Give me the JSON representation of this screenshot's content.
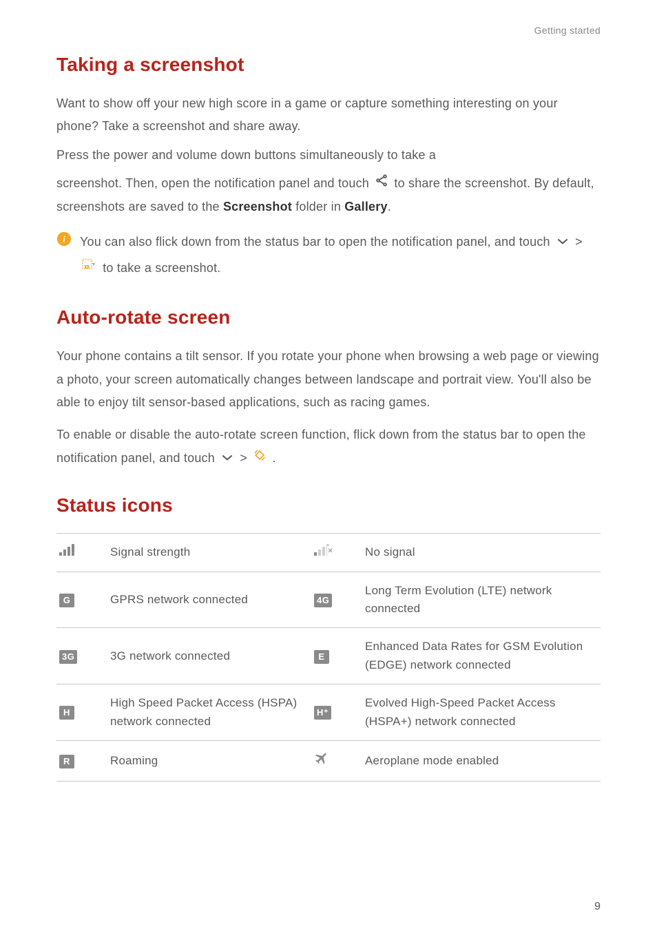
{
  "header": "Getting started",
  "section1": {
    "title": "Taking a screenshot",
    "para1_a": "Want to show off your new high score in a game or capture something interesting on your phone? Take a screenshot and share away.",
    "para1_b": "Press the power and volume down buttons simultaneously to take a",
    "para2_a": "screenshot. Then, open the notification panel and touch ",
    "para2_b": " to share the screenshot. By default, screenshots are saved to the ",
    "screenshot_bold": "Screenshot",
    "para2_c": " folder in ",
    "gallery_bold": "Gallery",
    "para2_d": ".",
    "info_a": "You can also flick down from the status bar to open the notification panel, and touch ",
    "info_b": " > ",
    "info_c": " to take a screenshot."
  },
  "section2": {
    "title": "Auto-rotate screen",
    "para1": "Your phone contains a tilt sensor. If you rotate your phone when browsing a web page or viewing a photo, your screen automatically changes between landscape and portrait view. You'll also be able to enjoy tilt sensor-based applications, such as racing games.",
    "para2_a": "To enable or disable the auto-rotate screen function, flick down from the status bar to open the notification panel, and touch ",
    "para2_b": " > ",
    "para2_c": " ."
  },
  "section3": {
    "title": "Status icons",
    "rows": [
      {
        "leftIcon": "signal-strength-icon",
        "left": "Signal strength",
        "rightIcon": "no-signal-icon",
        "right": "No signal"
      },
      {
        "leftIcon": "gprs-icon",
        "leftIconLabel": "G",
        "left": "GPRS network connected",
        "rightIcon": "4g-icon",
        "rightIconLabel": "4G",
        "right": "Long Term Evolution (LTE) network connected"
      },
      {
        "leftIcon": "3g-icon",
        "leftIconLabel": "3G",
        "left": "3G network connected",
        "rightIcon": "edge-icon",
        "rightIconLabel": "E",
        "right": "Enhanced Data Rates for GSM Evolution (EDGE) network connected"
      },
      {
        "leftIcon": "hspa-icon",
        "leftIconLabel": "H",
        "left": "High Speed Packet Access (HSPA) network connected",
        "rightIcon": "hspa-plus-icon",
        "rightIconLabel": "H⁺",
        "right": "Evolved High-Speed Packet Access (HSPA+) network connected"
      },
      {
        "leftIcon": "roaming-icon",
        "leftIconLabel": "R",
        "left": "Roaming",
        "rightIcon": "airplane-icon",
        "right": "Aeroplane mode enabled"
      }
    ]
  },
  "pageNumber": "9"
}
